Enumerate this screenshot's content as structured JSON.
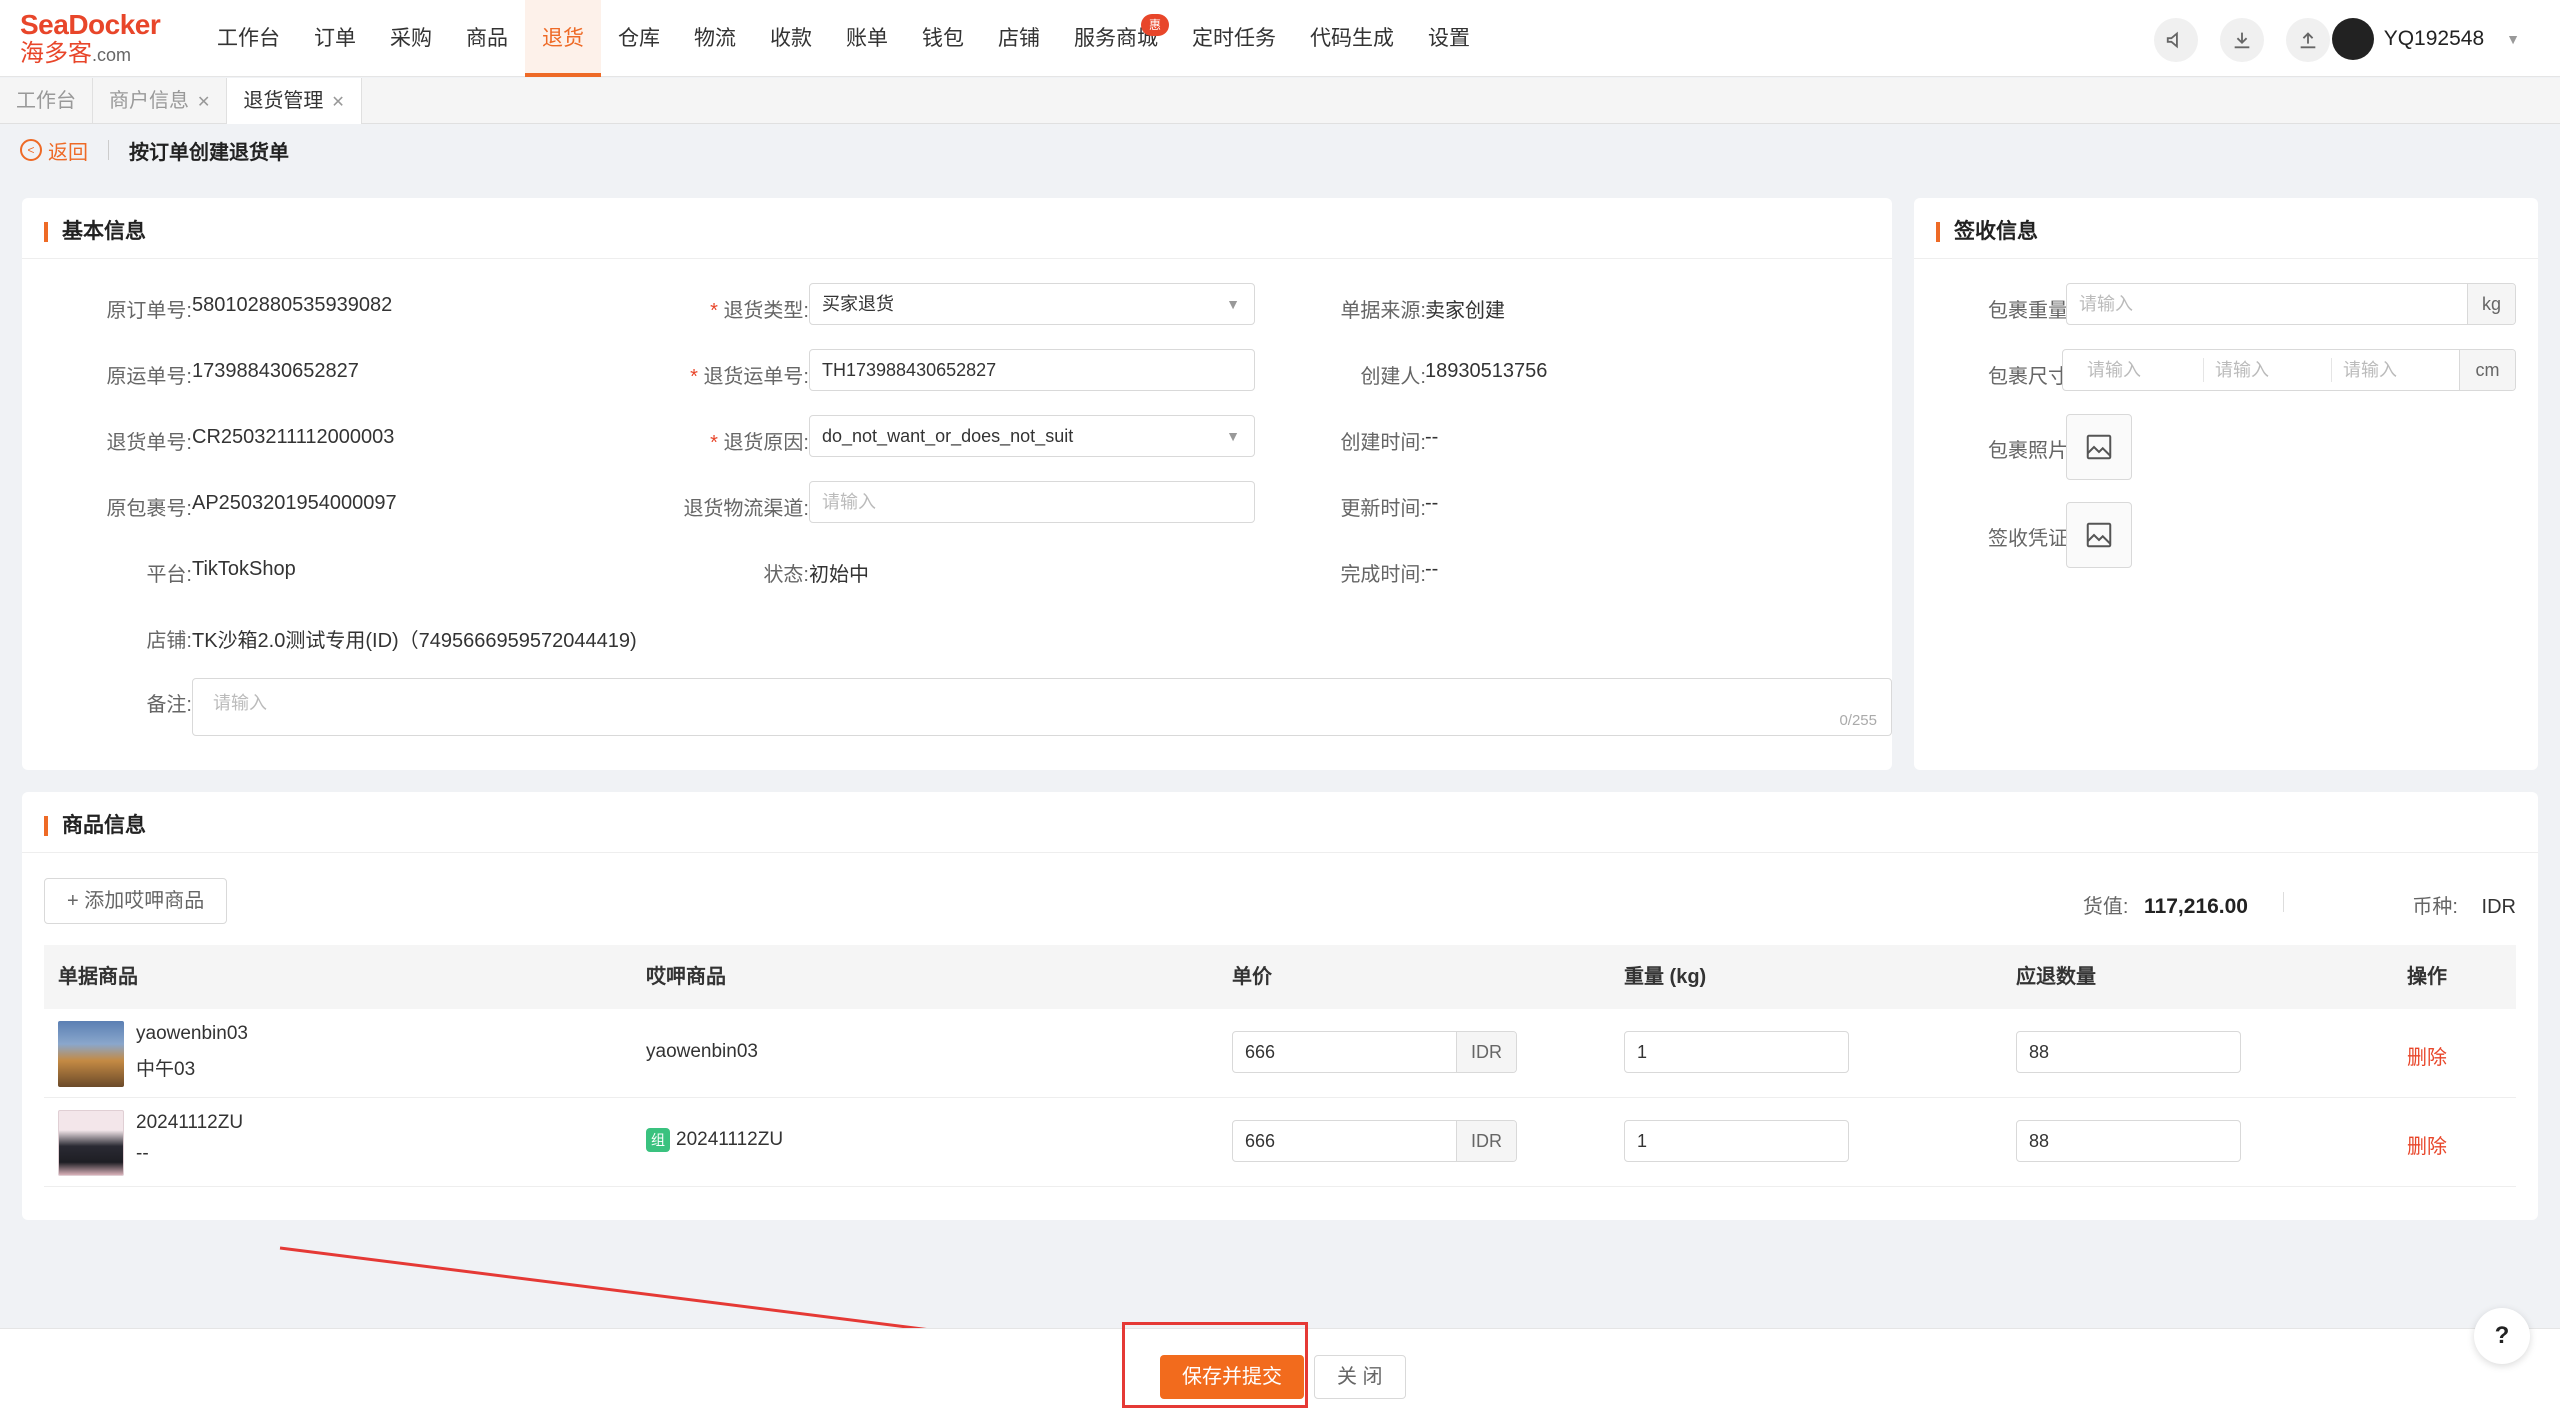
{
  "brand": {
    "line1": "SeaDocker",
    "line2": "海多客",
    "line2_suffix": ".com"
  },
  "menu": [
    {
      "label": "工作台"
    },
    {
      "label": "订单"
    },
    {
      "label": "采购"
    },
    {
      "label": "商品"
    },
    {
      "label": "退货",
      "active": true
    },
    {
      "label": "仓库"
    },
    {
      "label": "物流"
    },
    {
      "label": "收款"
    },
    {
      "label": "账单"
    },
    {
      "label": "钱包"
    },
    {
      "label": "店铺"
    },
    {
      "label": "服务商城",
      "badge": "惠"
    },
    {
      "label": "定时任务"
    },
    {
      "label": "代码生成"
    },
    {
      "label": "设置"
    }
  ],
  "user": {
    "name": "YQ192548"
  },
  "tabs": [
    {
      "label": "工作台"
    },
    {
      "label": "商户信息"
    },
    {
      "label": "退货管理"
    }
  ],
  "breadcrumb": {
    "back": "返回",
    "title": "按订单创建退货单"
  },
  "basic": {
    "title": "基本信息",
    "orig_order_label": "原订单号:",
    "orig_order": "580102880535939082",
    "orig_ship_label": "原运单号:",
    "orig_ship": "173988430652827",
    "return_no_label": "退货单号:",
    "return_no": "CR2503211112000003",
    "orig_pkg_label": "原包裹号:",
    "orig_pkg": "AP2503201954000097",
    "platform_label": "平台:",
    "platform": "TikTokShop",
    "store_label": "店铺:",
    "store": "TK沙箱2.0测试专用(ID)（7495666959572044419)",
    "remark_label": "备注:",
    "remark_placeholder": "请输入",
    "remark_counter": "0/255",
    "return_type_label": "退货类型:",
    "return_type": "买家退货",
    "return_ship_label": "退货运单号:",
    "return_ship": "TH173988430652827",
    "return_reason_label": "退货原因:",
    "return_reason": "do_not_want_or_does_not_suit",
    "channel_label": "退货物流渠道:",
    "channel_placeholder": "请输入",
    "status_label": "状态:",
    "status": "初始中",
    "source_label": "单据来源:",
    "source": "卖家创建",
    "creator_label": "创建人:",
    "creator": "18930513756",
    "created_label": "创建时间:",
    "created": "--",
    "updated_label": "更新时间:",
    "updated": "--",
    "finished_label": "完成时间:",
    "finished": "--"
  },
  "sign": {
    "title": "签收信息",
    "weight_label": "包裹重量",
    "weight_placeholder": "请输入",
    "weight_unit": "kg",
    "size_label": "包裹尺寸",
    "size_placeholder": "请输入",
    "size_unit": "cm",
    "photo_label": "包裹照片",
    "proof_label": "签收凭证"
  },
  "goods": {
    "title": "商品信息",
    "add_button": "添加哎呷商品",
    "value_label": "货值:",
    "value": "117,216.00",
    "currency_label": "币种:",
    "currency": "IDR",
    "headers": {
      "doc_goods": "单据商品",
      "sku_goods": "哎呷商品",
      "price": "单价",
      "weight": "重量 (kg)",
      "qty": "应退数量",
      "action": "操作"
    },
    "rows": [
      {
        "name": "yaowenbin03",
        "sub": "中午03",
        "sku": "yaowenbin03",
        "sku_tag": "",
        "price": "666",
        "currency": "IDR",
        "weight": "1",
        "qty": "88",
        "action": "删除"
      },
      {
        "name": "20241112ZU",
        "sub": "--",
        "sku": "20241112ZU",
        "sku_tag": "组",
        "price": "666",
        "currency": "IDR",
        "weight": "1",
        "qty": "88",
        "action": "删除"
      }
    ]
  },
  "footer": {
    "submit": "保存并提交",
    "close": "关 闭"
  },
  "help": "?"
}
